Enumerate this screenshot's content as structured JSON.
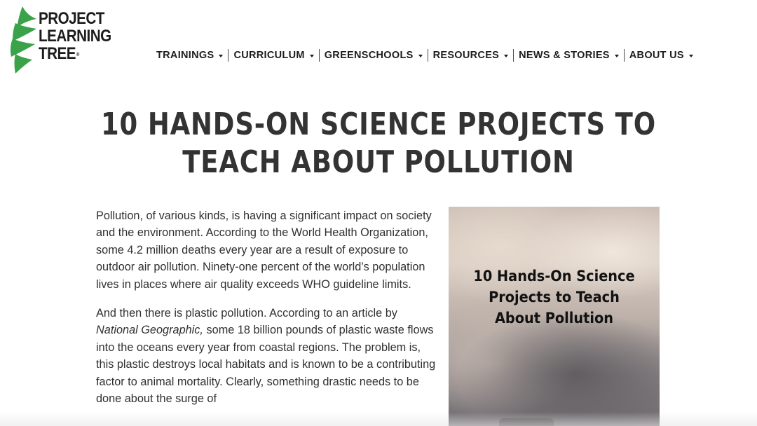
{
  "logo": {
    "lines": [
      "PROJECT",
      "LEARNING",
      "TREE"
    ],
    "trademark": "®",
    "color": "#3aa34a"
  },
  "nav": {
    "items": [
      {
        "label": "TRAININGS"
      },
      {
        "label": "CURRICULUM"
      },
      {
        "label": "GREENSCHOOLS"
      },
      {
        "label": "RESOURCES"
      },
      {
        "label": "NEWS & STORIES"
      },
      {
        "label": "ABOUT US"
      }
    ]
  },
  "page": {
    "title_line_1": "10 HANDS-ON SCIENCE PROJECTS TO",
    "title_line_2": "TEACH ABOUT POLLUTION"
  },
  "article": {
    "paragraph_1": "Pollution, of various kinds, is having a significant impact on society and the environment. According to the World Health Organization, some 4.2 million deaths every year are a result of exposure to outdoor air pollution. Ninety-one percent of the world’s population lives in places where air quality exceeds WHO guideline limits.",
    "paragraph_2_before": "And then there is plastic pollution. According to an article by ",
    "paragraph_2_italic": "National Geographic,",
    "paragraph_2_after": " some 18 billion pounds of plastic waste flows into the oceans every year from coastal regions. The problem is, this plastic destroys local habitats and is known to be a contributing factor to animal mortality.  Clearly, something drastic needs to be done about the surge of"
  },
  "feature_image": {
    "caption_lines": [
      "10 Hands-On Science",
      "Projects to Teach",
      "About Pollution"
    ]
  }
}
